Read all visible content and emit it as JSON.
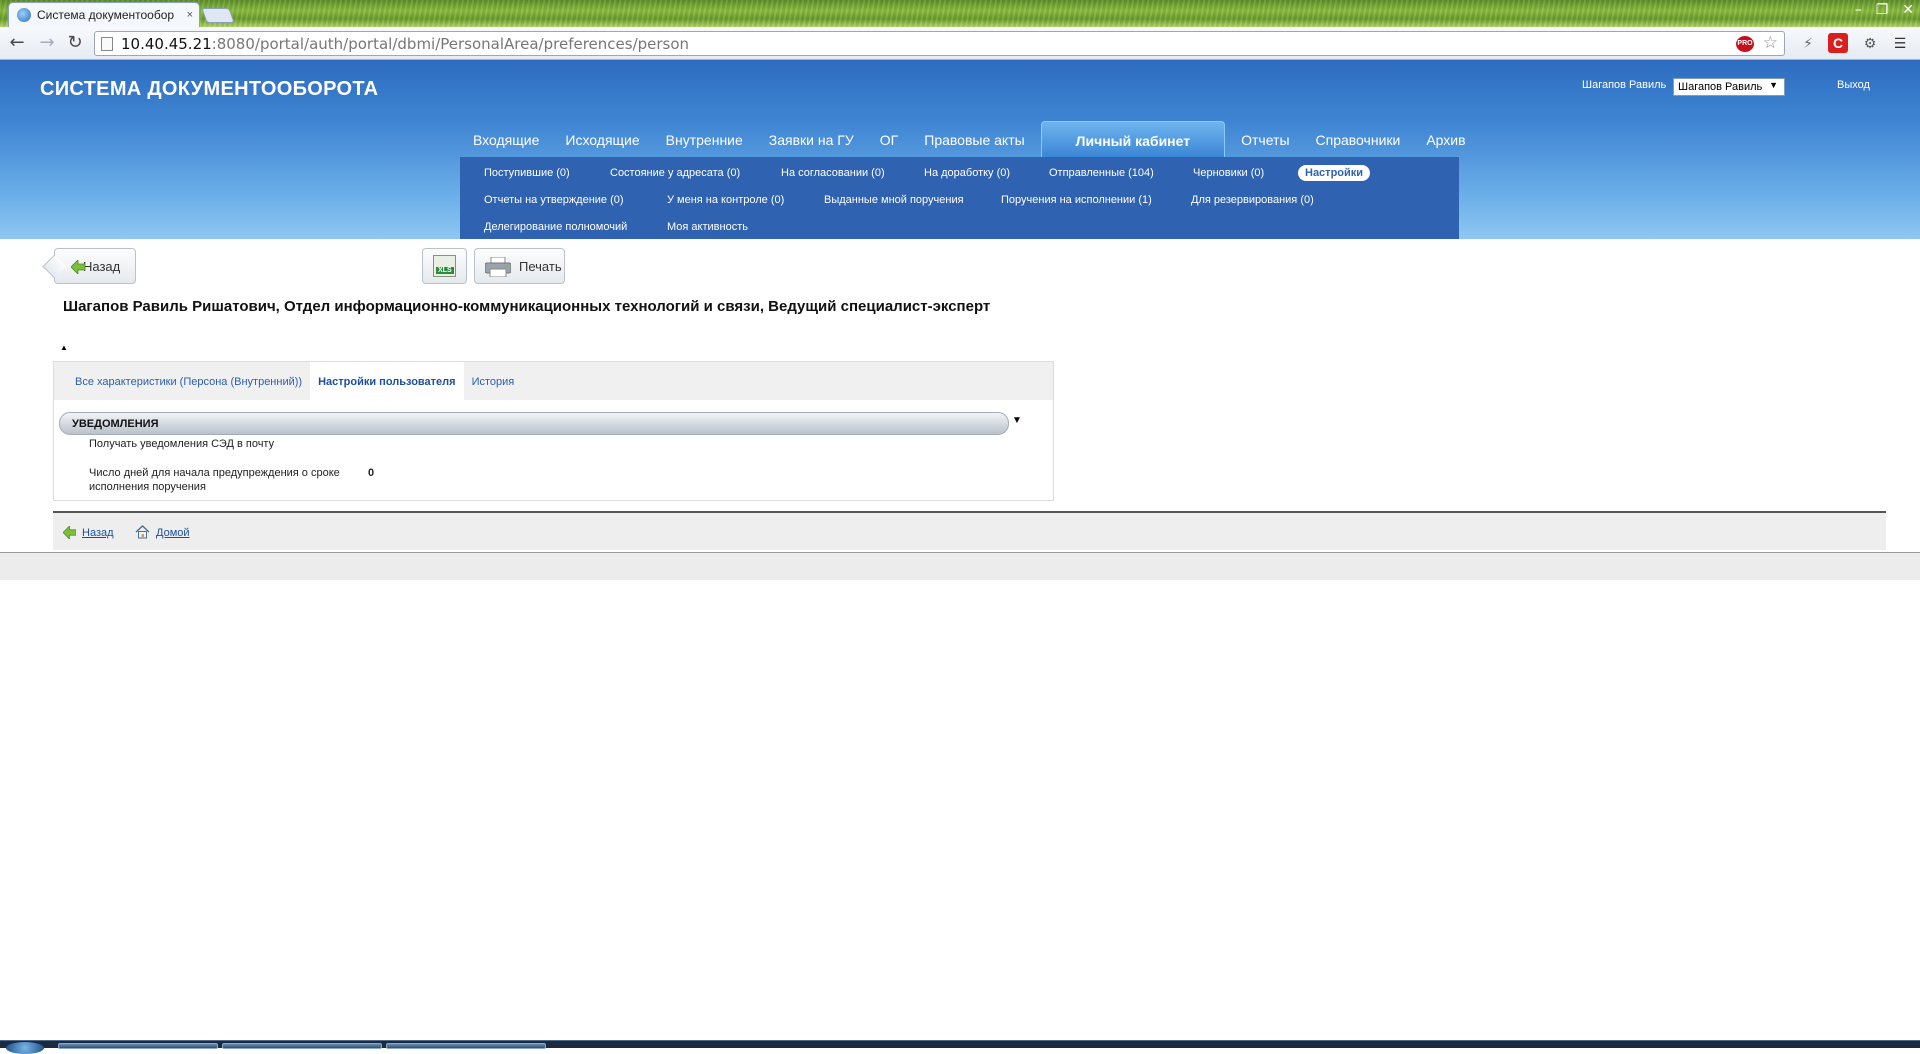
{
  "browser": {
    "tab_title": "Система документообор",
    "tab_close": "×",
    "url_host": "10.40.45.21",
    "url_rest": ":8080/portal/auth/portal/dbmi/PersonalArea/preferences/person",
    "pro_badge": "PRO",
    "window_controls": [
      "–",
      "❐",
      "✕"
    ]
  },
  "header": {
    "app_title": "СИСТЕМА ДОКУМЕНТООБОРОТА",
    "user_name": "Шагапов Равиль",
    "user_select_value": "Шагапов Равиль",
    "logout": "Выход"
  },
  "mainnav": {
    "items": [
      "Входящие",
      "Исходящие",
      "Внутренние",
      "Заявки на ГУ",
      "ОГ",
      "Правовые акты",
      "Личный кабинет",
      "Отчеты",
      "Справочники",
      "Архив"
    ],
    "active": "Личный кабинет"
  },
  "subnav": {
    "items": [
      "Поступившие (0)",
      "Состояние у адресата (0)",
      "На согласовании (0)",
      "На доработку (0)",
      "Отправленные (104)",
      "Черновики (0)",
      "Настройки",
      "Отчеты на утверждение (0)",
      "У меня на контроле (0)",
      "Выданные мной поручения",
      "Поручения на исполнении (1)",
      "Для резервирования (0)",
      "Делегирование полномочий",
      "Моя активность"
    ],
    "active": "Настройки"
  },
  "toolbar": {
    "back_label": "Назад",
    "xls_label": "XLS",
    "print_label": "Печать"
  },
  "person": {
    "title": "Шагапов Равиль Ришатович, Отдел информационно-коммуникационных технологий и связи, Ведущий специалист-эксперт"
  },
  "tabs": {
    "items": [
      "Все характеристики (Персона (Внутренний))",
      "Настройки пользователя",
      "История"
    ],
    "active": "Настройки пользователя"
  },
  "section": {
    "title": "УВЕДОМЛЕНИЯ",
    "field1_label": "Получать уведомления СЭД в почту",
    "field2_label_line1": "Число дней для начала предупреждения о сроке",
    "field2_label_line2": "исполнения поручения",
    "field2_value": "0"
  },
  "footer": {
    "back_link": "Назад",
    "home_link": "Домой"
  },
  "colors": {
    "header_blue": "#2d6cc0",
    "subnav_blue": "#2f62b0",
    "link_blue": "#1d4fa0"
  }
}
